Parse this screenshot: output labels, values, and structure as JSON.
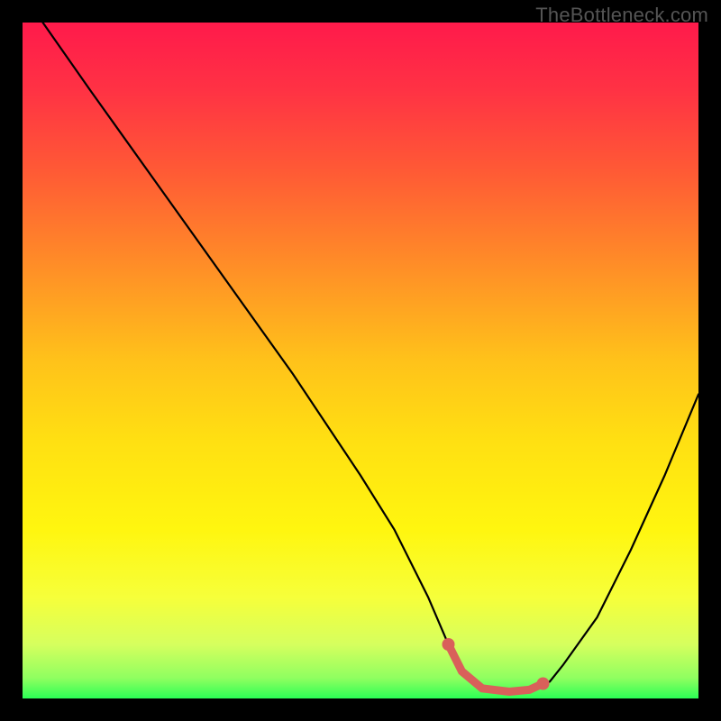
{
  "watermark": "TheBottleneck.com",
  "gradient_stops": [
    {
      "offset": 0.0,
      "color": "#ff1a4b"
    },
    {
      "offset": 0.1,
      "color": "#ff3244"
    },
    {
      "offset": 0.22,
      "color": "#ff5a35"
    },
    {
      "offset": 0.35,
      "color": "#ff8a28"
    },
    {
      "offset": 0.5,
      "color": "#ffc21a"
    },
    {
      "offset": 0.62,
      "color": "#ffe012"
    },
    {
      "offset": 0.75,
      "color": "#fff60f"
    },
    {
      "offset": 0.85,
      "color": "#f6ff3a"
    },
    {
      "offset": 0.92,
      "color": "#d6ff5e"
    },
    {
      "offset": 0.97,
      "color": "#8fff60"
    },
    {
      "offset": 1.0,
      "color": "#2cff55"
    }
  ],
  "chart_data": {
    "type": "line",
    "title": "",
    "xlabel": "",
    "ylabel": "",
    "xlim": [
      0,
      100
    ],
    "ylim": [
      0,
      100
    ],
    "series": [
      {
        "name": "curve",
        "x": [
          3,
          10,
          20,
          30,
          40,
          50,
          55,
          60,
          63,
          65,
          68,
          72,
          75,
          78,
          80,
          85,
          90,
          95,
          100
        ],
        "y": [
          100,
          90,
          76,
          62,
          48,
          33,
          25,
          15,
          8,
          4,
          1.5,
          1,
          1.3,
          2.5,
          5,
          12,
          22,
          33,
          45
        ]
      },
      {
        "name": "highlight",
        "x": [
          63,
          65,
          68,
          72,
          75,
          77
        ],
        "y": [
          8,
          4,
          1.5,
          1,
          1.3,
          2.2
        ]
      }
    ],
    "markers": [
      {
        "x": 63,
        "y": 8,
        "r": 3.2
      },
      {
        "x": 77,
        "y": 2.2,
        "r": 3.2
      }
    ],
    "colors": {
      "curve": "#000000",
      "highlight": "#d9605a",
      "marker": "#d9605a"
    }
  }
}
